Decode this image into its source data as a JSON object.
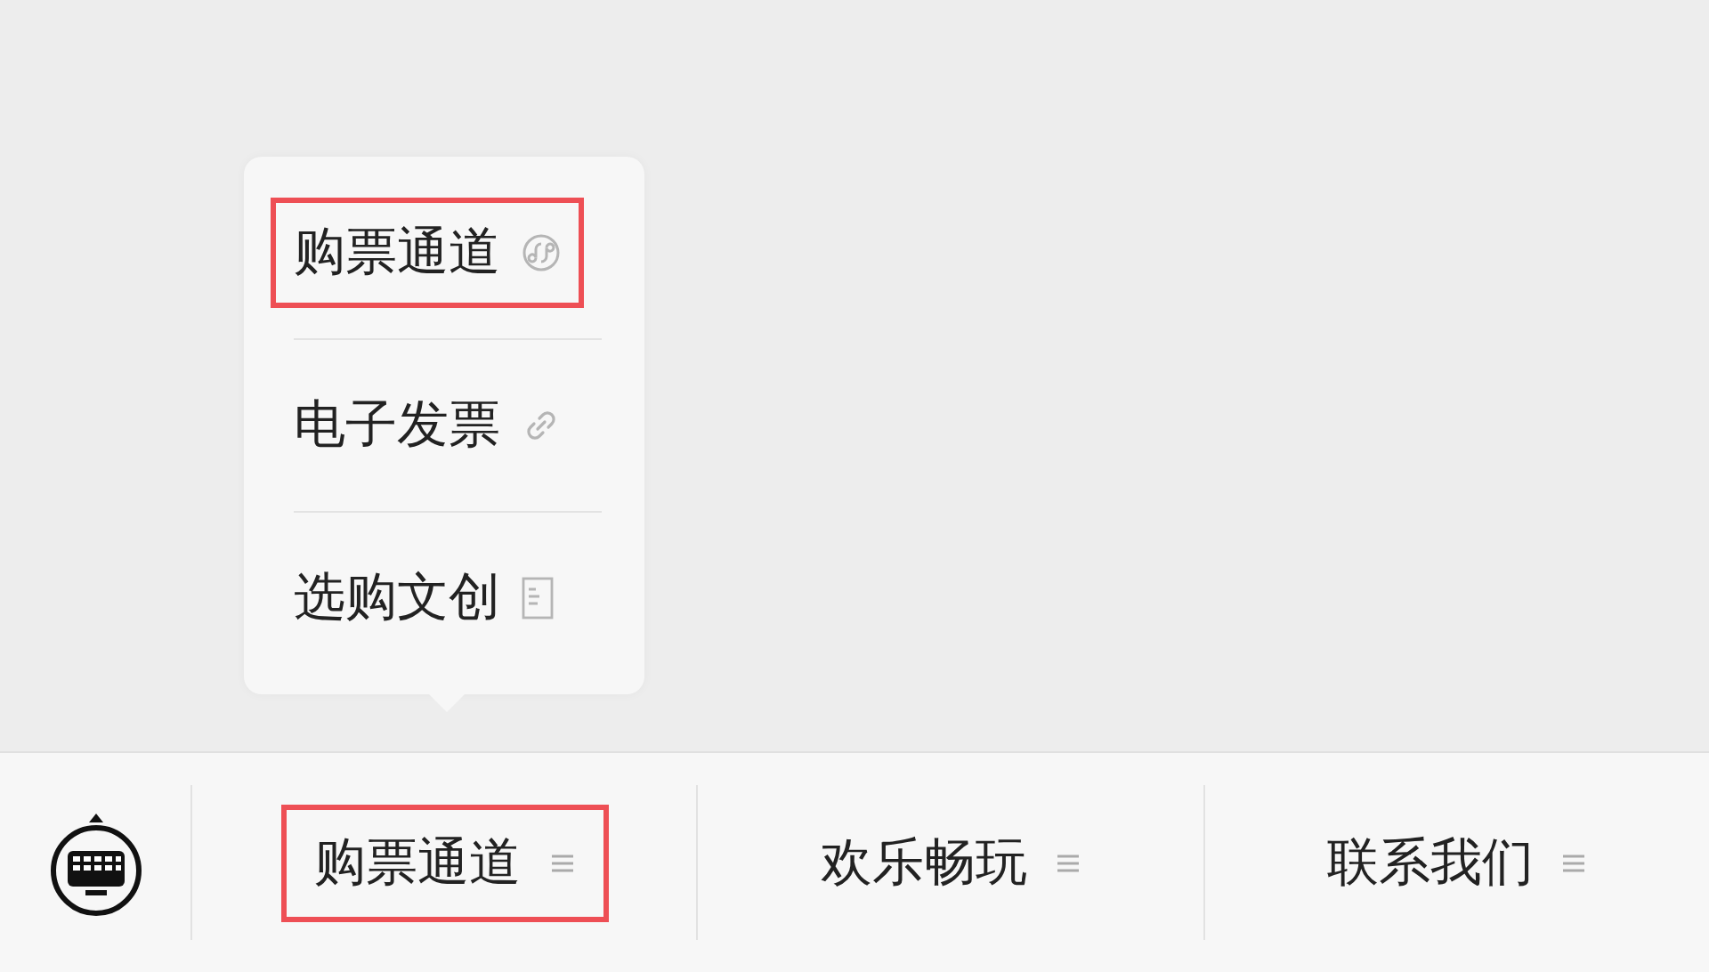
{
  "popup": {
    "items": [
      {
        "label": "购票通道",
        "kind": "miniprogram",
        "highlighted": true
      },
      {
        "label": "电子发票",
        "kind": "link",
        "highlighted": false
      },
      {
        "label": "选购文创",
        "kind": "article",
        "highlighted": false
      }
    ]
  },
  "menu_bar": {
    "items": [
      {
        "label": "购票通道",
        "highlighted": true
      },
      {
        "label": "欢乐畅玩",
        "highlighted": false
      },
      {
        "label": "联系我们",
        "highlighted": false
      }
    ]
  }
}
